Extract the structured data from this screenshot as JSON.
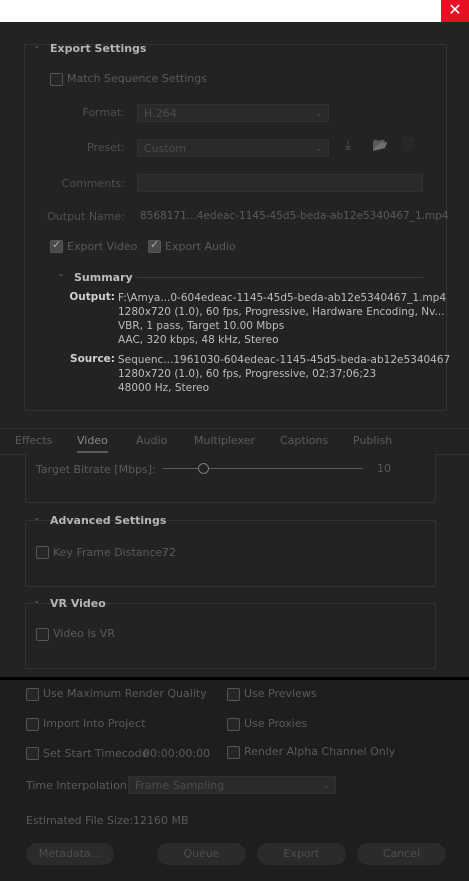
{
  "window": {
    "close_glyph": "✕"
  },
  "export_settings": {
    "title": "Export Settings",
    "match_sequence": "Match Sequence Settings",
    "format_label": "Format:",
    "format_value": "H.264",
    "preset_label": "Preset:",
    "preset_value": "Custom",
    "comments_label": "Comments:",
    "output_name_label": "Output Name:",
    "output_name_value": "8568171...4edeac-1145-45d5-beda-ab12e5340467_1.mp4",
    "export_video": "Export Video",
    "export_audio": "Export Audio",
    "summary": {
      "title": "Summary",
      "output_label": "Output:",
      "output_lines": [
        "F:\\Amya...0-604edeac-1145-45d5-beda-ab12e5340467_1.mp4",
        "1280x720 (1.0), 60 fps, Progressive, Hardware Encoding, Nv...",
        "VBR, 1 pass, Target 10.00 Mbps",
        "AAC, 320 kbps, 48 kHz, Stereo"
      ],
      "source_label": "Source:",
      "source_lines": [
        "Sequenc...1961030-604edeac-1145-45d5-beda-ab12e5340467",
        "1280x720 (1.0), 60 fps, Progressive, 02;37;06;23",
        "48000 Hz, Stereo"
      ]
    }
  },
  "tabs": [
    "Effects",
    "Video",
    "Audio",
    "Multiplexer",
    "Captions",
    "Publish"
  ],
  "active_tab": "Video",
  "bitrate": {
    "label": "Target Bitrate [Mbps]:",
    "value": "10",
    "level": 0.2
  },
  "advanced": {
    "title": "Advanced Settings",
    "key_frame_label": "Key Frame Distance:",
    "key_frame_value": "72"
  },
  "vr": {
    "title": "VR Video",
    "video_is_vr": "Video Is VR"
  },
  "options": {
    "max_render_quality": "Use Maximum Render Quality",
    "use_previews": "Use Previews",
    "import_into_project": "Import Into Project",
    "use_proxies": "Use Proxies",
    "set_start_timecode": "Set Start Timecode",
    "start_timecode_value": "00:00:00:00",
    "render_alpha": "Render Alpha Channel Only",
    "time_interp_label": "Time Interpolation:",
    "time_interp_value": "Frame Sampling",
    "file_size_label": "Estimated File Size:",
    "file_size_value": "12160 MB"
  },
  "buttons": {
    "metadata": "Metadata...",
    "queue": "Queue",
    "export": "Export",
    "cancel": "Cancel"
  },
  "icons": {
    "dropdown": "⌄",
    "chevron": "⌄",
    "save_preset": "⤓",
    "import_preset": "📂",
    "delete_preset": "🗑"
  }
}
